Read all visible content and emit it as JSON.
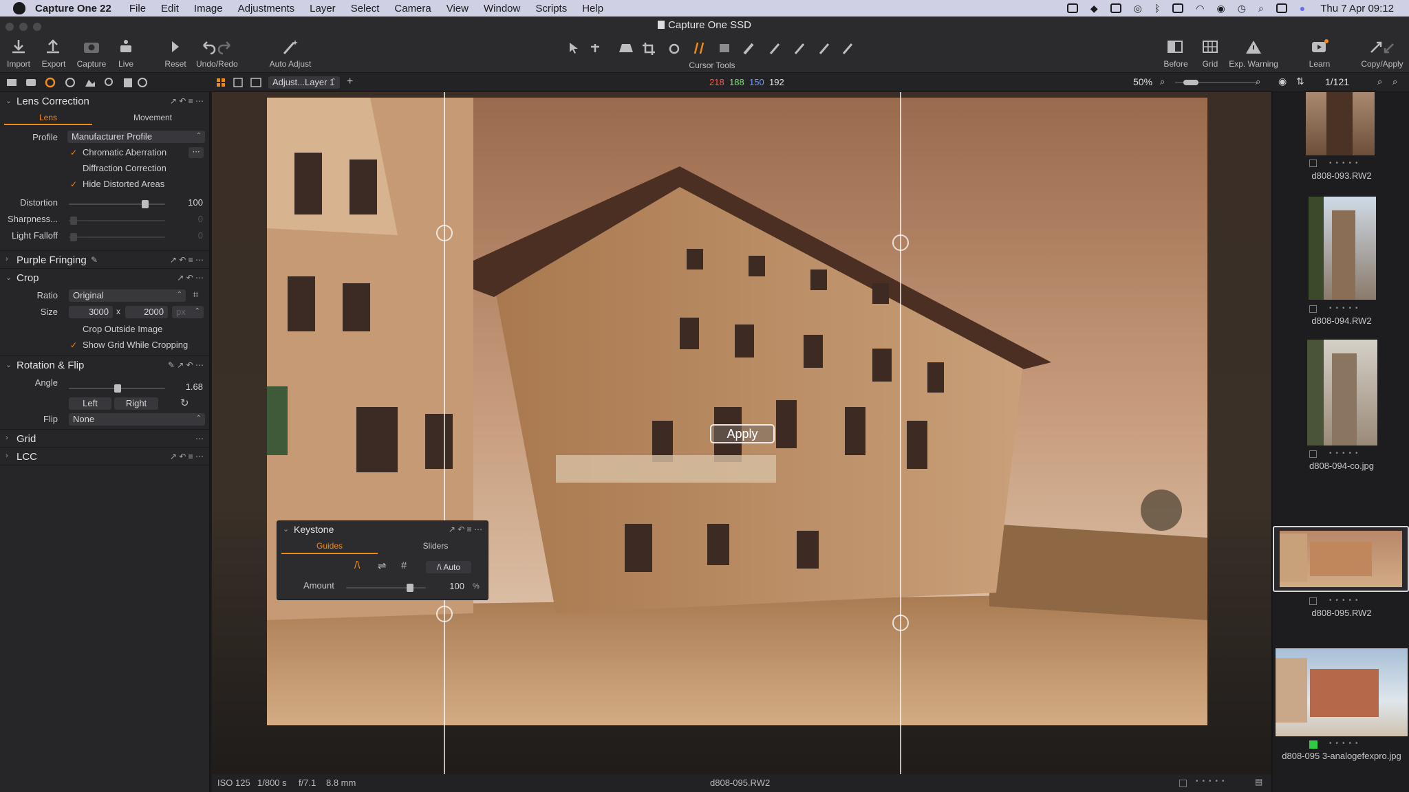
{
  "menubar": {
    "app_name": "Capture One 22",
    "items": [
      "File",
      "Edit",
      "Image",
      "Adjustments",
      "Layer",
      "Select",
      "Camera",
      "View",
      "Window",
      "Scripts",
      "Help"
    ],
    "clock": "Thu 7 Apr  09:12"
  },
  "window": {
    "title": "Capture One SSD"
  },
  "toolbar": {
    "import": "Import",
    "export": "Export",
    "capture": "Capture",
    "live": "Live",
    "reset": "Reset",
    "undo_redo": "Undo/Redo",
    "auto_adjust": "Auto Adjust",
    "cursor_tools": "Cursor Tools",
    "before": "Before",
    "grid": "Grid",
    "exp_warning": "Exp. Warning",
    "learn": "Learn",
    "copy_apply": "Copy/Apply"
  },
  "subtoolbar": {
    "layer_selector": "Adjust...Layer 1",
    "rgb": {
      "r": "218",
      "g": "188",
      "b": "150",
      "l": "192"
    },
    "zoom": "50%",
    "image_count": "1/121"
  },
  "lens_correction": {
    "title": "Lens Correction",
    "tabs": [
      "Lens",
      "Movement"
    ],
    "profile_label": "Profile",
    "profile_value": "Manufacturer Profile",
    "chromatic_aberration": "Chromatic Aberration",
    "diffraction_correction": "Diffraction Correction",
    "hide_distorted": "Hide Distorted Areas",
    "distortion_label": "Distortion",
    "distortion_value": "100",
    "sharpness_label": "Sharpness...",
    "sharpness_value": "0",
    "light_falloff_label": "Light Falloff",
    "light_falloff_value": "0"
  },
  "purple_fringing": {
    "title": "Purple Fringing"
  },
  "crop": {
    "title": "Crop",
    "ratio_label": "Ratio",
    "ratio_value": "Original",
    "size_label": "Size",
    "width": "3000",
    "x": "x",
    "height": "2000",
    "unit": "px",
    "crop_outside": "Crop Outside Image",
    "show_grid": "Show Grid While Cropping"
  },
  "rotation": {
    "title": "Rotation & Flip",
    "angle_label": "Angle",
    "angle_value": "1.68",
    "left": "Left",
    "right": "Right",
    "flip_label": "Flip",
    "flip_value": "None"
  },
  "grid_section": {
    "title": "Grid"
  },
  "lcc_section": {
    "title": "LCC"
  },
  "viewer": {
    "apply_label": "Apply"
  },
  "keystone": {
    "title": "Keystone",
    "tabs": [
      "Guides",
      "Sliders"
    ],
    "auto_label": "Auto",
    "amount_label": "Amount",
    "amount_value": "100",
    "amount_unit": "%"
  },
  "status": {
    "iso": "ISO 125",
    "shutter": "1/800 s",
    "aperture": "f/7.1",
    "focal": "8.8 mm",
    "filename": "d808-095.RW2"
  },
  "filmstrip": [
    {
      "name": "d808-093.RW2"
    },
    {
      "name": "d808-094.RW2"
    },
    {
      "name": "d808-094-co.jpg"
    },
    {
      "name": "d808-095.RW2"
    },
    {
      "name": "d808-095 3-analogefexpro.jpg"
    }
  ],
  "colors": {
    "accent": "#f08b1a",
    "panel": "#262629",
    "menubar": "#cfd0e3",
    "red": "#ff5a4a",
    "green": "#7ee07a",
    "blue": "#6a9cff"
  }
}
